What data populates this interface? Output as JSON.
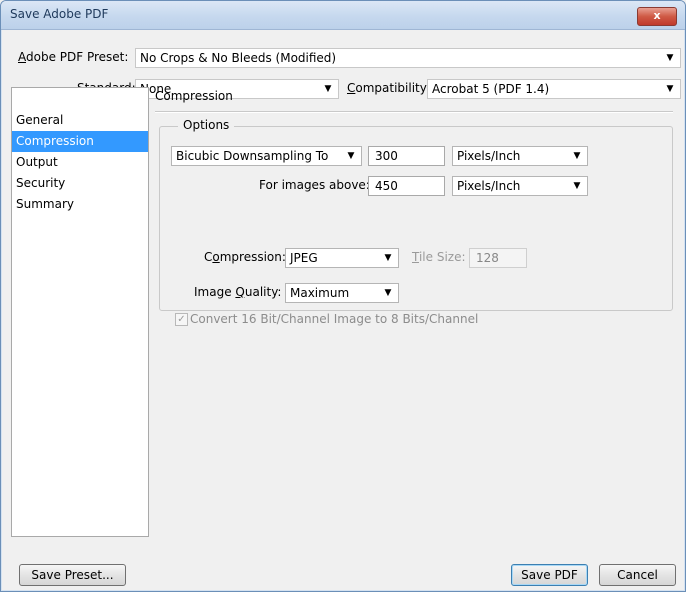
{
  "window": {
    "title": "Save Adobe PDF",
    "close_label": "x"
  },
  "preset": {
    "label": "Adobe PDF Preset:",
    "value": "No Crops & No Bleeds (Modified)"
  },
  "standard": {
    "label": "Standard:",
    "value": "None"
  },
  "compatibility": {
    "label": "Compatibility:",
    "value": "Acrobat 5 (PDF 1.4)"
  },
  "sidebar": {
    "items": [
      {
        "label": "General"
      },
      {
        "label": "Compression",
        "selected": true
      },
      {
        "label": "Output"
      },
      {
        "label": "Security"
      },
      {
        "label": "Summary"
      }
    ]
  },
  "panel": {
    "heading": "Compression",
    "group_title": "Options",
    "downsampling": {
      "value": "Bicubic Downsampling To",
      "ppi": "300",
      "unit": "Pixels/Inch"
    },
    "images_above": {
      "label": "For images above:",
      "ppi": "450",
      "unit": "Pixels/Inch"
    },
    "compression": {
      "label": "Compression:",
      "value": "JPEG"
    },
    "tile_size": {
      "label": "Tile Size:",
      "value": "128"
    },
    "image_quality": {
      "label": "Image Quality:",
      "value": "Maximum"
    },
    "convert_checkbox": {
      "label": "Convert 16 Bit/Channel Image to 8 Bits/Channel",
      "checked": true
    }
  },
  "buttons": {
    "save_preset": "Save Preset...",
    "save_pdf": "Save PDF",
    "cancel": "Cancel"
  },
  "icons": {
    "dropdown_arrow": "▼",
    "check": "✓"
  }
}
